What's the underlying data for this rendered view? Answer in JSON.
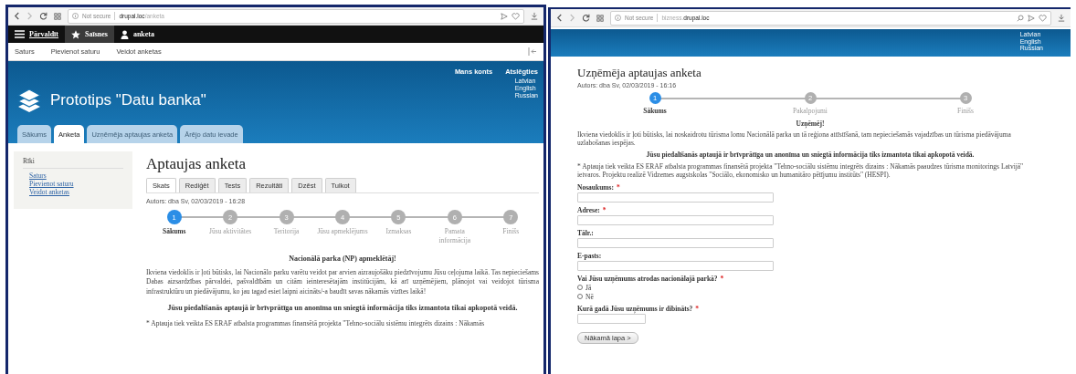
{
  "left_window": {
    "browser": {
      "security": "Not secure",
      "url": [
        {
          "text": "drupal.loc",
          "dim": false
        },
        {
          "text": "/anketa",
          "dim": true
        }
      ]
    },
    "admin_toolbar": [
      {
        "label": "Pārvaldīt",
        "kind": "menu",
        "selected": false
      },
      {
        "label": "Saīsnes",
        "kind": "star",
        "selected": true
      },
      {
        "label": "anketa",
        "kind": "user",
        "selected": false
      }
    ],
    "shortcuts": [
      "Saturs",
      "Pievienot saturu",
      "Veidot anketas"
    ],
    "header": {
      "user_links": [
        "Mans konts",
        "Atslēgties"
      ],
      "site_name": "Prototips \"Datu banka\"",
      "languages": [
        "Latvian",
        "English",
        "Russian"
      ],
      "tabs": [
        {
          "label": "Sākums",
          "selected": false
        },
        {
          "label": "Anketa",
          "selected": true
        },
        {
          "label": "Uzņēmēja aptaujas anketa",
          "selected": false
        },
        {
          "label": "Ārējo datu ievade",
          "selected": false
        }
      ]
    },
    "sidebar": {
      "title": "Rīki",
      "links": [
        "Saturs",
        "Pievienot saturu",
        "Veidot anketas"
      ]
    },
    "main": {
      "title": "Aptaujas anketa",
      "tabs": [
        {
          "label": "Skats",
          "selected": true
        },
        {
          "label": "Rediģēt",
          "selected": false
        },
        {
          "label": "Tests",
          "selected": false
        },
        {
          "label": "Rezultāti",
          "selected": false
        },
        {
          "label": "Dzēst",
          "selected": false
        },
        {
          "label": "Tulkot",
          "selected": false
        }
      ],
      "meta": "Autors: dba Sv, 02/03/2019 - 16:28",
      "steps": [
        {
          "number": "1",
          "label": "Sākums",
          "selected": true
        },
        {
          "number": "2",
          "label": "Jūsu aktivitātes",
          "selected": false
        },
        {
          "number": "3",
          "label": "Teritorija",
          "selected": false
        },
        {
          "number": "4",
          "label": "Jūsu apmeklējums",
          "selected": false
        },
        {
          "number": "5",
          "label": "Izmaksas",
          "selected": false
        },
        {
          "number": "6",
          "label": "Pamata informācija",
          "selected": false
        },
        {
          "number": "7",
          "label": "Finišs",
          "selected": false
        }
      ],
      "greeting": "Nacionālā parka (NP) apmeklētāj!",
      "intro": "Ikviena viedoklis ir ļoti būtisks, lai Nacionālo parku varētu veidot par arvien aizraujošāku piedzīvojumu Jūsu ceļojuma laikā. Tas nepieciešams Dabas aizsardzības pārvaldei, pašvaldībām un citām ieinteresētajām institūcijām, kā arī uzņēmējiem, plānojot vai veidojot tūrisma infrastruktūru un piedāvājumu, ko jau tagad esiet laipni aicināts/-a baudīt savas nākamās vizītes laikā!",
      "notice": "Jūsu piedalīšanās aptaujā ir brīvprātīga un anonīma un sniegtā informācija tiks izmantota tikai apkopotā veidā.",
      "footnote": "* Aptauja tiek veikta ES ERAF atbalsta programmas finansētā projekta \"Tehno-sociālu sistēmu integrēts dizains : Nākamās"
    }
  },
  "right_window": {
    "browser": {
      "security": "Not secure",
      "url": [
        {
          "text": "bizness.",
          "dim": true
        },
        {
          "text": "drupal.loc",
          "dim": false
        }
      ]
    },
    "header": {
      "languages": [
        "Latvian",
        "English",
        "Russian"
      ]
    },
    "main": {
      "title": "Uzņēmēja aptaujas anketa",
      "meta": "Autors: dba Sv, 02/03/2019 - 16:16",
      "steps": [
        {
          "number": "1",
          "label": "Sākums",
          "selected": true
        },
        {
          "number": "2",
          "label": "Pakalpojumi",
          "selected": false
        },
        {
          "number": "3",
          "label": "Finišs",
          "selected": false
        }
      ],
      "greeting": "Uzņēmēj!",
      "intro": "Ikviena viedoklis ir ļoti būtisks, lai noskaidrotu tūrisma lomu Nacionālā parka un tā reģiona attīstīšanā, tam nepieciešamās vajadzības un tūrisma piedāvājuma uzlabošanas iespējas.",
      "notice": "Jūsu piedalīšanās aptaujā ir brīvprātīga un anonīma un sniegtā informācija tiks izmantota tikai apkopotā veidā.",
      "footnote": "* Aptauja tiek veikta ES ERAF atbalsta programmas finansētā projekta \"Tehno-sociālu sistēmu integrēts dizains : Nākamās paaudzes tūrisma monitorings Latvijā\" ietvaros. Projektu realizē Vidzemes augstskolas \"Sociālo, ekonomisko un humanitāro pētījumu institūts\" (HESPI).",
      "fields": [
        {
          "kind": "text",
          "label": "Nosaukums:",
          "required_mark": "*"
        },
        {
          "kind": "text",
          "label": "Adrese:",
          "required_mark": "*"
        },
        {
          "kind": "text",
          "label": "Tālr.:"
        },
        {
          "kind": "text",
          "label": "E-pasts:"
        },
        {
          "kind": "radio",
          "label": "Vai Jūsu uzņēmums atrodas nacionālajā parkā?",
          "required_mark": "*",
          "options": [
            {
              "label": "Jā",
              "checked": false
            },
            {
              "label": "Nē",
              "checked": false
            }
          ]
        },
        {
          "kind": "short_text",
          "label": "Kurā gadā Jūsu uzņēmums ir dibināts?",
          "required_mark": "*"
        }
      ],
      "submit": "Nākamā lapa >"
    }
  }
}
